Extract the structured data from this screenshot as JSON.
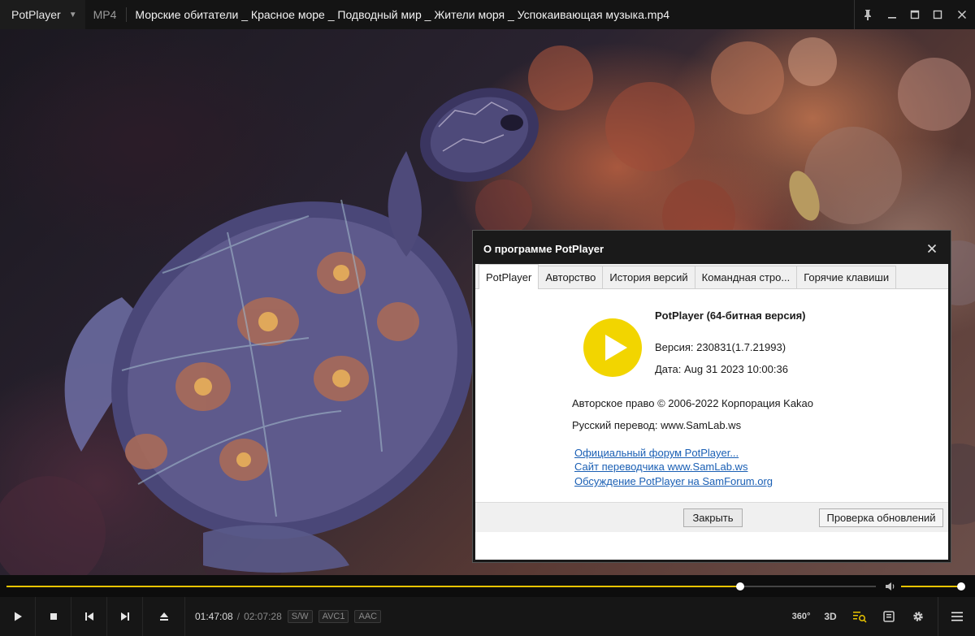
{
  "titlebar": {
    "app_name": "PotPlayer",
    "format": "MP4",
    "file_title": "Морские обитатели _ Красное море _ Подводный мир _ Жители моря _ Успокаивающая музыка.mp4"
  },
  "dialog": {
    "title": "О программе PotPlayer",
    "tabs": [
      {
        "label": "PotPlayer",
        "active": true
      },
      {
        "label": "Авторство",
        "active": false
      },
      {
        "label": "История версий",
        "active": false
      },
      {
        "label": "Командная стро...",
        "active": false
      },
      {
        "label": "Горячие клавиши",
        "active": false
      }
    ],
    "product": "PotPlayer (64-битная версия)",
    "version": "Версия: 230831(1.7.21993)",
    "date": "Дата: Aug 31 2023 10:00:36",
    "copyright": "Авторское право © 2006-2022 Корпорация Kakao",
    "translation": "Русский перевод: www.SamLab.ws",
    "links": [
      "Официальный форум PotPlayer...",
      "Сайт переводчика www.SamLab.ws",
      "Обсуждение PotPlayer на SamForum.org"
    ],
    "close_button": "Закрыть",
    "update_button": "Проверка обновлений",
    "logo_color": "#f2d500"
  },
  "playback": {
    "current_time": "01:47:08",
    "separator": "/",
    "total_time": "02:07:28",
    "progress_percent": 84.4,
    "volume_percent": 100,
    "accent_color": "#e8c400",
    "tags": [
      "S/W",
      "AVC1",
      "AAC"
    ],
    "btn_360": "360°",
    "btn_3d": "3D"
  }
}
